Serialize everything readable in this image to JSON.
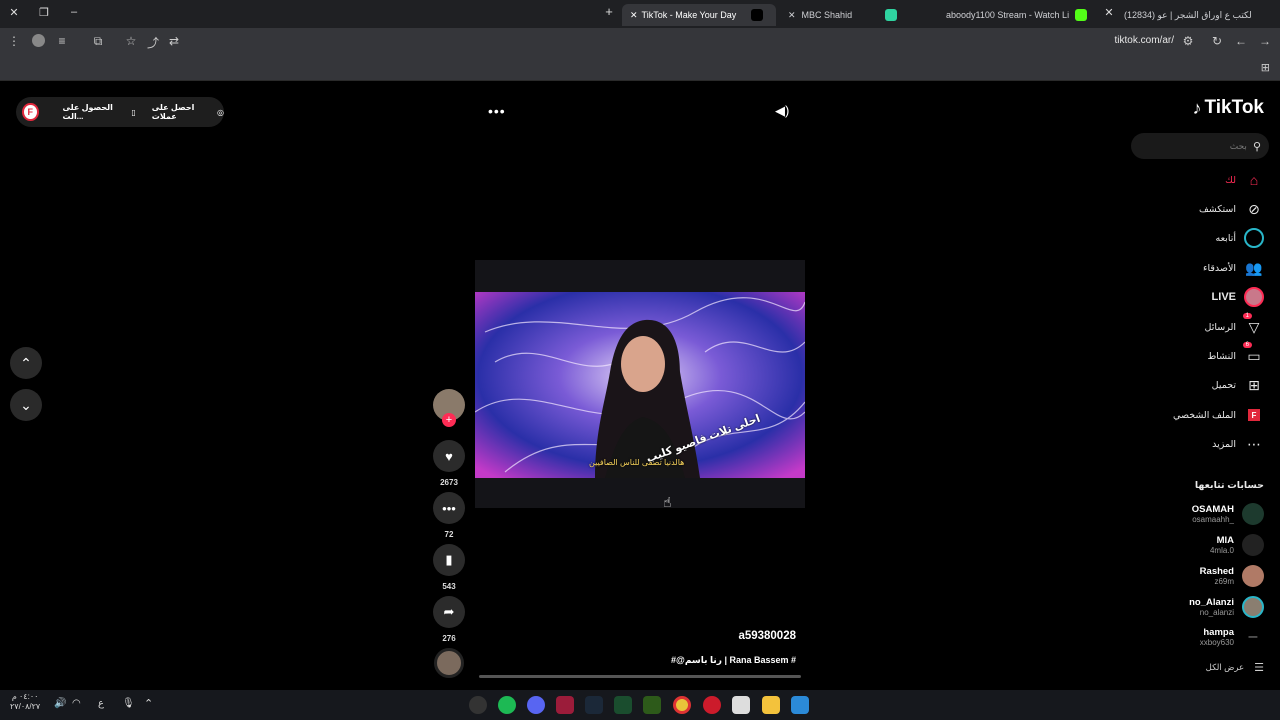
{
  "browser": {
    "tabs": [
      {
        "label": "TikTok - Make Your Day",
        "active": true
      },
      {
        "label": "MBC Shahid",
        "active": false
      },
      {
        "label": "aboody1100 Stream - Watch Li",
        "active": false
      },
      {
        "label": "(12834) لكتب ع اوراق الشجر | عو",
        "active": false
      }
    ],
    "url": "tiktok.com/ar/"
  },
  "sidebar": {
    "logo": "TikTok",
    "search_placeholder": "بحث",
    "items": [
      {
        "label": "لك",
        "icon": "home-icon",
        "highlight": true
      },
      {
        "label": "استكشف",
        "icon": "compass-icon"
      },
      {
        "label": "أتابعه",
        "icon": "following-icon"
      },
      {
        "label": "الأصدقاء",
        "icon": "friends-icon"
      },
      {
        "label": "LIVE",
        "icon": "live-icon"
      },
      {
        "label": "الرسائل",
        "icon": "messages-icon",
        "badge": "1"
      },
      {
        "label": "النشاط",
        "icon": "activity-icon",
        "badge": "6"
      },
      {
        "label": "تحميل",
        "icon": "upload-icon"
      },
      {
        "label": "الملف الشخصي",
        "icon": "profile-icon"
      },
      {
        "label": "المزيد",
        "icon": "more-icon"
      }
    ],
    "following_title": "حسابات تتابعها",
    "accounts": [
      {
        "name": "OSAMAH",
        "username": "osamaahh_"
      },
      {
        "name": "MIA",
        "username": "4mla.0"
      },
      {
        "name": "Rashed",
        "username": "z69m"
      },
      {
        "name": "no_Alanzi",
        "username": "no_alanzi"
      },
      {
        "name": "hampa",
        "username": "xxboy630"
      }
    ],
    "see_all": "عرض الكل"
  },
  "topbar": {
    "coins_label": "احصل على عملات",
    "app_label": "الحصول على الت...",
    "avatar_letter": "F"
  },
  "video": {
    "caption_line1": "احلى تلات فاصيو كليب",
    "caption_line2": "هالدنيا تصفى للناس الصافيين",
    "author": "a59380028",
    "description": "#@رنا باسم | Rana Bassem #"
  },
  "actions": {
    "likes": "2673",
    "comments": "72",
    "saves": "543",
    "shares": "276"
  },
  "taskbar": {
    "time": "٠٤:٠٠ م",
    "date": "٢٧/٠٨/٢٧",
    "lang": "ع"
  }
}
